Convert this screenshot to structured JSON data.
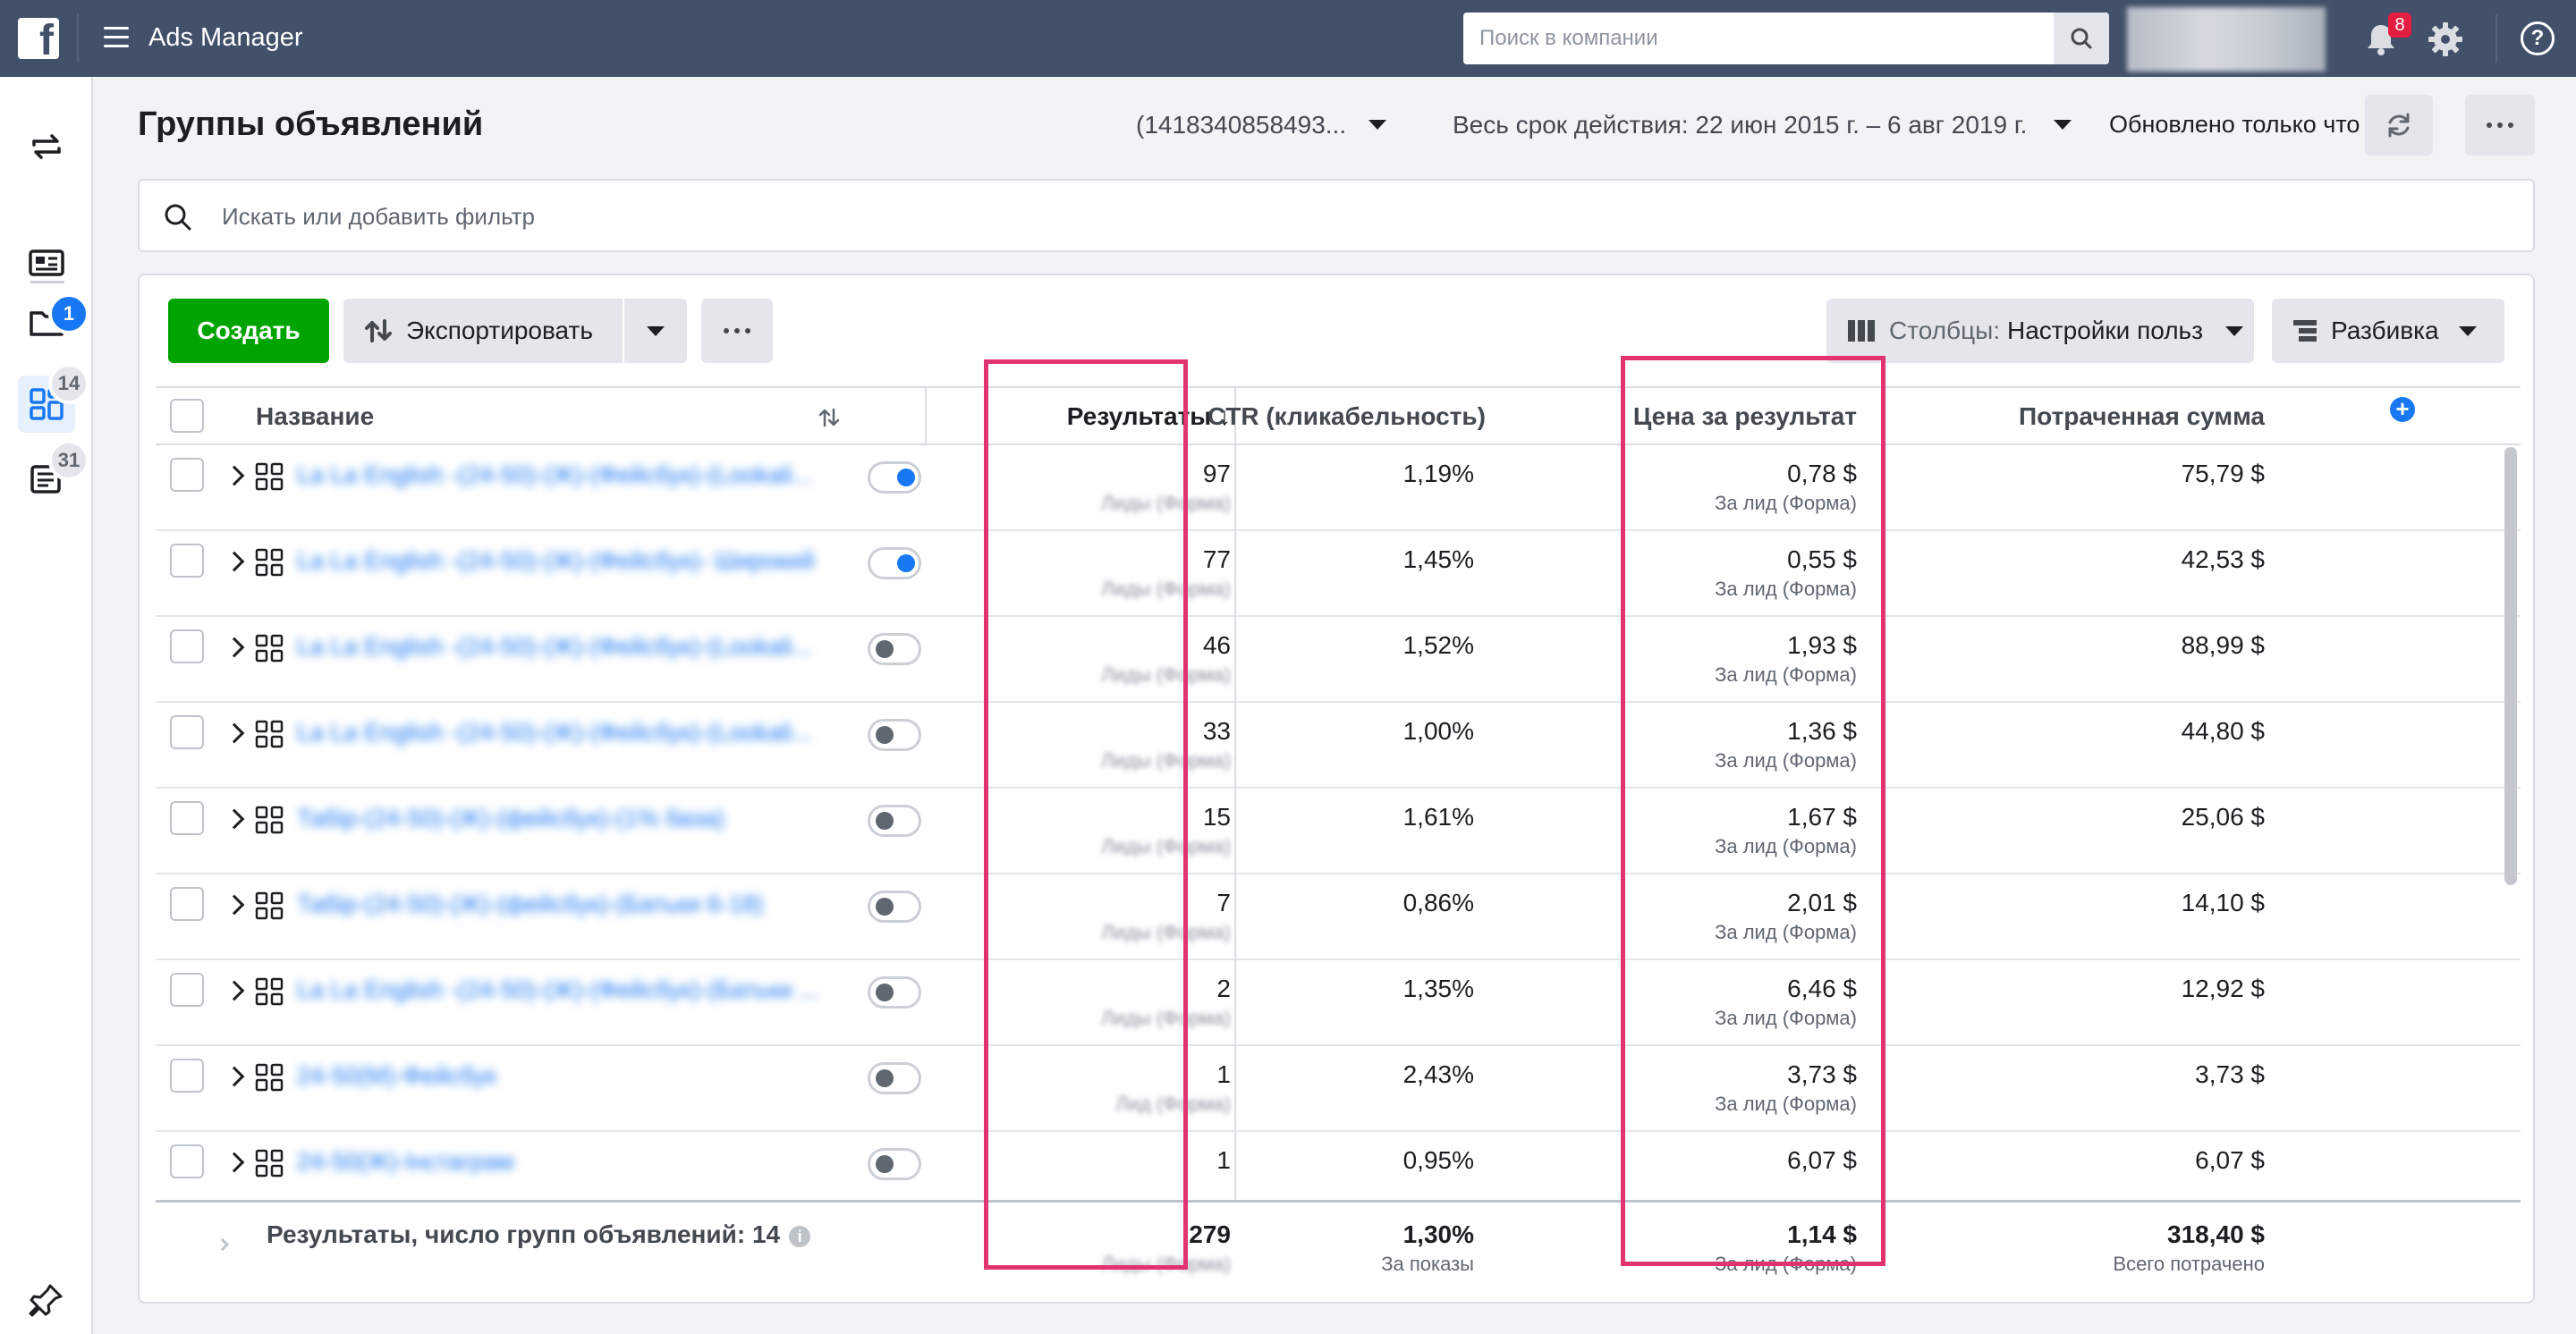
{
  "topbar": {
    "logo": "f",
    "app_title": "Ads Manager",
    "search_placeholder": "Поиск в компании",
    "notifications_count": "8",
    "help_label": "?"
  },
  "rail": {
    "badges": {
      "campaigns": "1",
      "adsets": "14",
      "ads": "31"
    }
  },
  "header": {
    "title": "Группы объявлений",
    "account": "(1418340858493...",
    "date_range": "Весь срок действия: 22 июн 2015 г. – 6 авг 2019 г.",
    "updated": "Обновлено только что"
  },
  "filter": {
    "placeholder": "Искать или добавить фильтр"
  },
  "toolbar": {
    "create": "Создать",
    "export": "Экспортировать",
    "columns_prefix": "Столбцы:",
    "columns_value": "Настройки польз",
    "breakdown": "Разбивка"
  },
  "table": {
    "columns": {
      "name": "Название",
      "results": "Результаты ↓",
      "ctr": "CTR (кликабельность)",
      "cost": "Цена за результат",
      "spent": "Потраченная сумма"
    },
    "rows": [
      {
        "name": "La La English -(24-50)-(Ж)-(Фейсбук)-(Lookali...",
        "on": true,
        "results": "97",
        "results_sub": "Лиды (Форма)",
        "ctr": "1,19%",
        "cost": "0,78 $",
        "cost_sub": "За лид (Форма)",
        "spent": "75,79 $"
      },
      {
        "name": "La La English -(24-50)-(Ж)-(Фейсбук)- Широкий",
        "on": true,
        "results": "77",
        "results_sub": "Лиды (Форма)",
        "ctr": "1,45%",
        "cost": "0,55 $",
        "cost_sub": "За лид (Форма)",
        "spent": "42,53 $"
      },
      {
        "name": "La La English -(24-50)-(Ж)-(Фейсбук)-(Lookali...",
        "on": false,
        "results": "46",
        "results_sub": "Лиды (Форма)",
        "ctr": "1,52%",
        "cost": "1,93 $",
        "cost_sub": "За лид (Форма)",
        "spent": "88,99 $"
      },
      {
        "name": "La La English -(24-50)-(Ж)-(Фейсбук)-(Lookali...",
        "on": false,
        "results": "33",
        "results_sub": "Лиды (Форма)",
        "ctr": "1,00%",
        "cost": "1,36 $",
        "cost_sub": "За лид (Форма)",
        "spent": "44,80 $"
      },
      {
        "name": "Табір-(24-50)-(Ж)-(фейсбук)-(1% база)",
        "on": false,
        "results": "15",
        "results_sub": "Лиды (Форма)",
        "ctr": "1,61%",
        "cost": "1,67 $",
        "cost_sub": "За лид (Форма)",
        "spent": "25,06 $"
      },
      {
        "name": "Табір-(24-50)-(Ж)-(фейсбук)-(Батьки 6-18)",
        "on": false,
        "results": "7",
        "results_sub": "Лиды (Форма)",
        "ctr": "0,86%",
        "cost": "2,01 $",
        "cost_sub": "За лид (Форма)",
        "spent": "14,10 $"
      },
      {
        "name": "La La English -(24-50)-(Ж)-(Фейсбук)-(Батьки ...",
        "on": false,
        "results": "2",
        "results_sub": "Лиды (Форма)",
        "ctr": "1,35%",
        "cost": "6,46 $",
        "cost_sub": "За лид (Форма)",
        "spent": "12,92 $"
      },
      {
        "name": "24-50(М)-Фейсбук",
        "on": false,
        "results": "1",
        "results_sub": "Лид (Форма)",
        "ctr": "2,43%",
        "cost": "3,73 $",
        "cost_sub": "За лид (Форма)",
        "spent": "3,73 $"
      },
      {
        "name": "24-50(Ж)-Інстаграм",
        "on": false,
        "results": "1",
        "results_sub": "",
        "ctr": "0,95%",
        "cost": "6,07 $",
        "cost_sub": "",
        "spent": "6,07 $"
      }
    ],
    "footer": {
      "label": "Результаты, число групп объявлений: 14",
      "info": "i",
      "results": "279",
      "results_sub": "Лиды (Форма)",
      "ctr": "1,30%",
      "ctr_sub": "За показы",
      "cost": "1,14 $",
      "cost_sub": "За лид (Форма)",
      "spent": "318,40 $",
      "spent_sub": "Всего потрачено"
    }
  },
  "colors": {
    "topbar": "#42506a",
    "create_button": "#00a400",
    "accent_blue": "#1877f2",
    "highlight": "#e0336f",
    "notification_badge": "#e41e3f"
  }
}
